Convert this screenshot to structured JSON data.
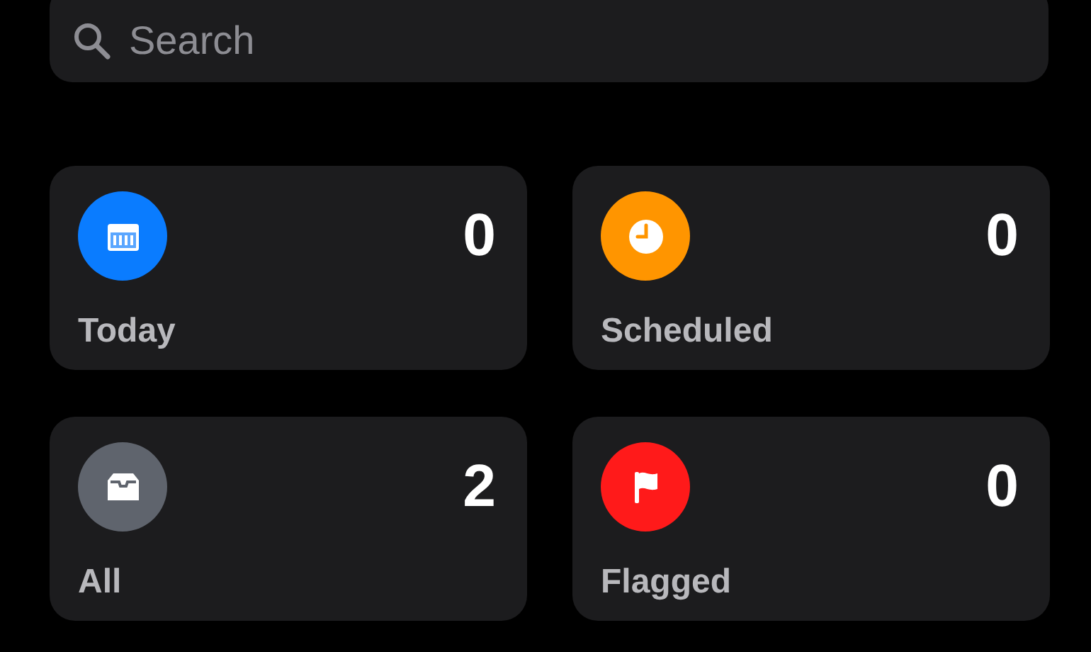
{
  "search": {
    "placeholder": "Search"
  },
  "lists": [
    {
      "label": "Today",
      "count": "0",
      "kind": "calendar",
      "color": "#0a7cff"
    },
    {
      "label": "Scheduled",
      "count": "0",
      "kind": "clock",
      "color": "#ff9500"
    },
    {
      "label": "All",
      "count": "2",
      "kind": "tray",
      "color": "#5f646d"
    },
    {
      "label": "Flagged",
      "count": "0",
      "kind": "flag",
      "color": "#ff1a1a"
    }
  ]
}
